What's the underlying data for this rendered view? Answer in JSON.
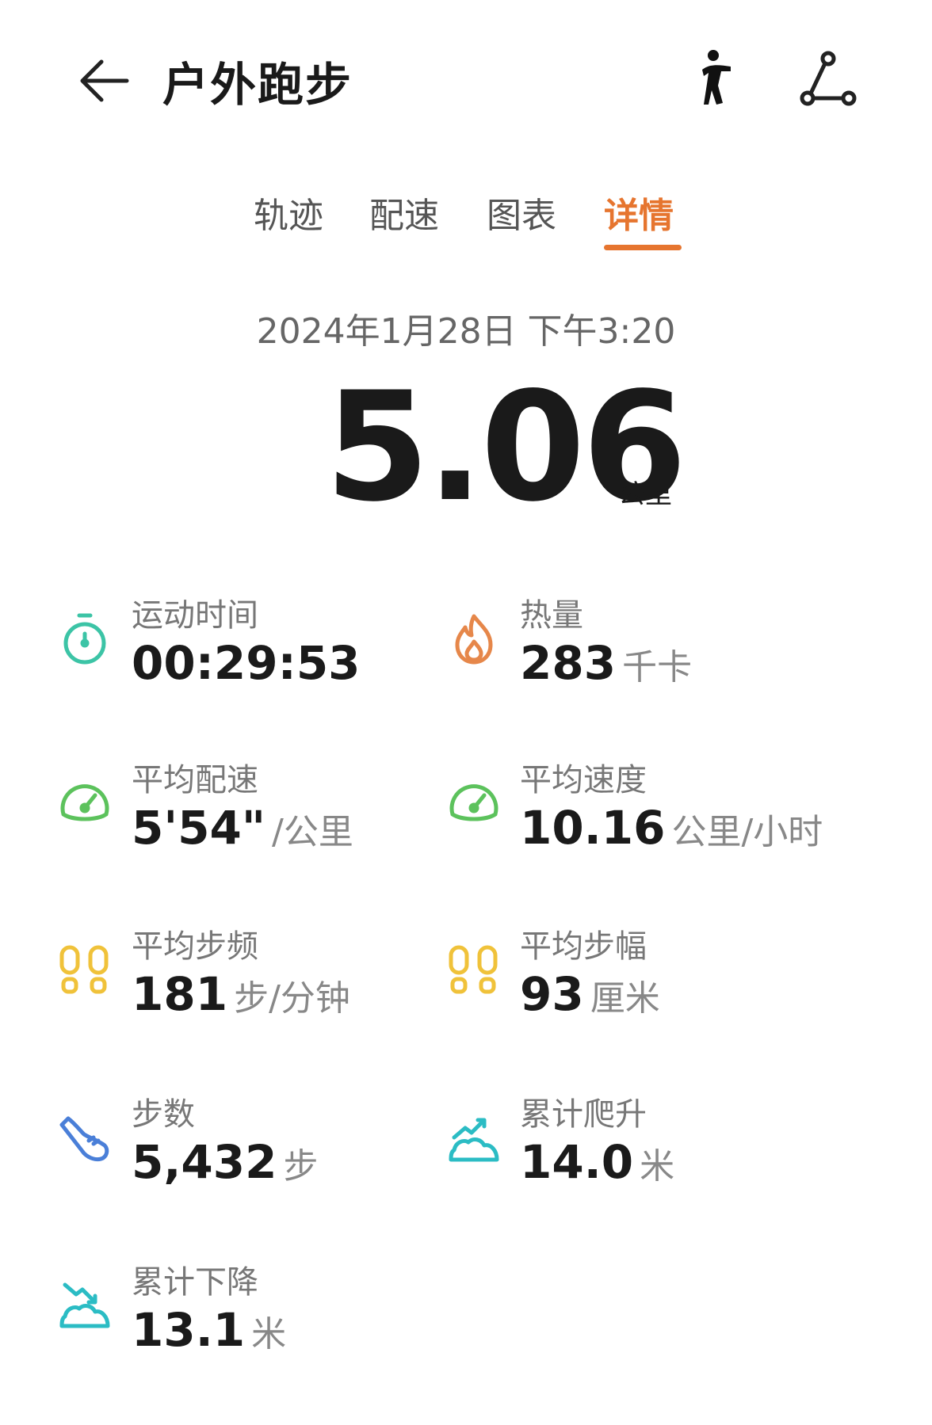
{
  "header": {
    "title": "户外跑步",
    "back_icon": "arrow-left-icon",
    "run_icon": "running-figure-icon",
    "share_icon": "share-nodes-icon"
  },
  "tabs": [
    {
      "label": "轨迹",
      "active": false
    },
    {
      "label": "配速",
      "active": false
    },
    {
      "label": "图表",
      "active": false
    },
    {
      "label": "详情",
      "active": true
    }
  ],
  "summary": {
    "date": "2024年1月28日 下午3:20",
    "distance": "5.06",
    "distance_unit": "公里"
  },
  "stats": {
    "duration": {
      "label": "运动时间",
      "value": "00:29:53",
      "unit": "",
      "icon": "stopwatch-icon",
      "color": "#3cc4a6"
    },
    "calories": {
      "label": "热量",
      "value": "283",
      "unit": "千卡",
      "icon": "flame-icon",
      "color": "#e6874a"
    },
    "avg_pace": {
      "label": "平均配速",
      "value": "5'54\"",
      "unit": "/公里",
      "icon": "speedometer-icon",
      "color": "#5cc25c"
    },
    "avg_speed": {
      "label": "平均速度",
      "value": "10.16",
      "unit": "公里/小时",
      "icon": "speedometer-icon",
      "color": "#5cc25c"
    },
    "avg_cadence": {
      "label": "平均步频",
      "value": "181",
      "unit": "步/分钟",
      "icon": "footprints-icon",
      "color": "#f0c23a"
    },
    "avg_stride": {
      "label": "平均步幅",
      "value": "93",
      "unit": "厘米",
      "icon": "footprints-icon",
      "color": "#f0c23a"
    },
    "steps": {
      "label": "步数",
      "value": "5,432",
      "unit": "步",
      "icon": "shoe-icon",
      "color": "#4a7fd8"
    },
    "total_ascent": {
      "label": "累计爬升",
      "value": "14.0",
      "unit": "米",
      "icon": "mountain-up-icon",
      "color": "#2bbcc4"
    },
    "total_descent": {
      "label": "累计下降",
      "value": "13.1",
      "unit": "米",
      "icon": "mountain-down-icon",
      "color": "#2bbcc4"
    }
  }
}
